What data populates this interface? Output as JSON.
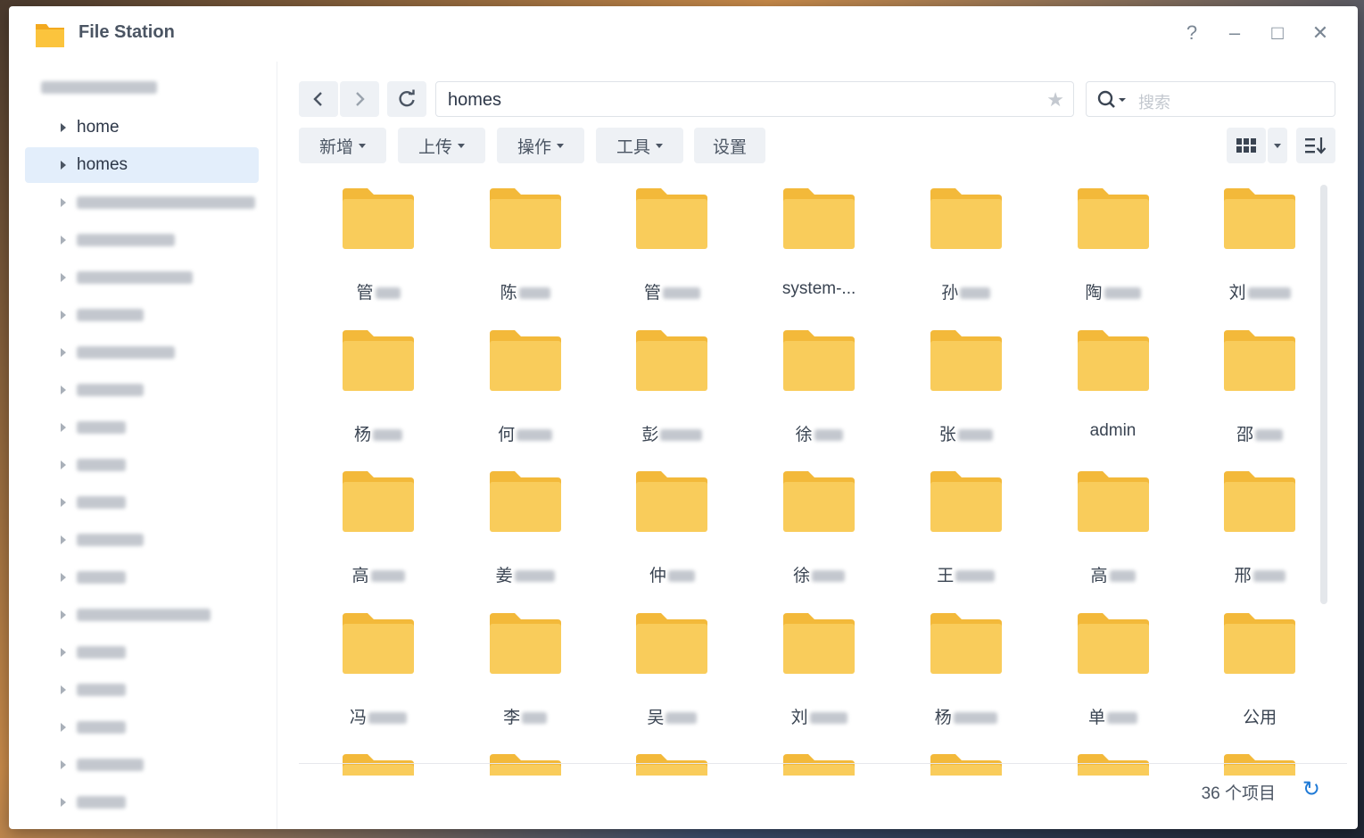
{
  "window": {
    "title": "File Station",
    "controls": {
      "help": "?",
      "minimize": "–",
      "maximize": "□",
      "close": "✕"
    }
  },
  "sidebar": {
    "items": [
      {
        "label": "home"
      },
      {
        "label": "homes",
        "selected": true
      }
    ]
  },
  "toolbar": {
    "path": "homes",
    "search_placeholder": "搜索",
    "buttons": {
      "new": "新增",
      "upload": "上传",
      "action": "操作",
      "tools": "工具",
      "settings": "设置"
    }
  },
  "folders": [
    {
      "prefix": "管"
    },
    {
      "prefix": "陈"
    },
    {
      "prefix": "管"
    },
    {
      "prefix": "system-..."
    },
    {
      "prefix": "孙"
    },
    {
      "prefix": "陶"
    },
    {
      "prefix": "刘"
    },
    {
      "prefix": "杨"
    },
    {
      "prefix": "何"
    },
    {
      "prefix": "彭"
    },
    {
      "prefix": "徐"
    },
    {
      "prefix": "张"
    },
    {
      "prefix": "admin"
    },
    {
      "prefix": "邵"
    },
    {
      "prefix": "高"
    },
    {
      "prefix": "姜"
    },
    {
      "prefix": "仲"
    },
    {
      "prefix": "徐"
    },
    {
      "prefix": "王"
    },
    {
      "prefix": "高"
    },
    {
      "prefix": "邢"
    },
    {
      "prefix": "冯"
    },
    {
      "prefix": "李"
    },
    {
      "prefix": "吴"
    },
    {
      "prefix": "刘"
    },
    {
      "prefix": "杨"
    },
    {
      "prefix": "单"
    },
    {
      "prefix": "公用"
    },
    {
      "prefix": ""
    },
    {
      "prefix": ""
    },
    {
      "prefix": ""
    },
    {
      "prefix": ""
    },
    {
      "prefix": ""
    },
    {
      "prefix": ""
    },
    {
      "prefix": ""
    }
  ],
  "status": {
    "count": "36 个项目"
  },
  "colors": {
    "folder": "#f9cc5b",
    "folder_tab": "#f3b93a",
    "selected_bg": "#e3eefb",
    "accent": "#1f7ad6"
  }
}
